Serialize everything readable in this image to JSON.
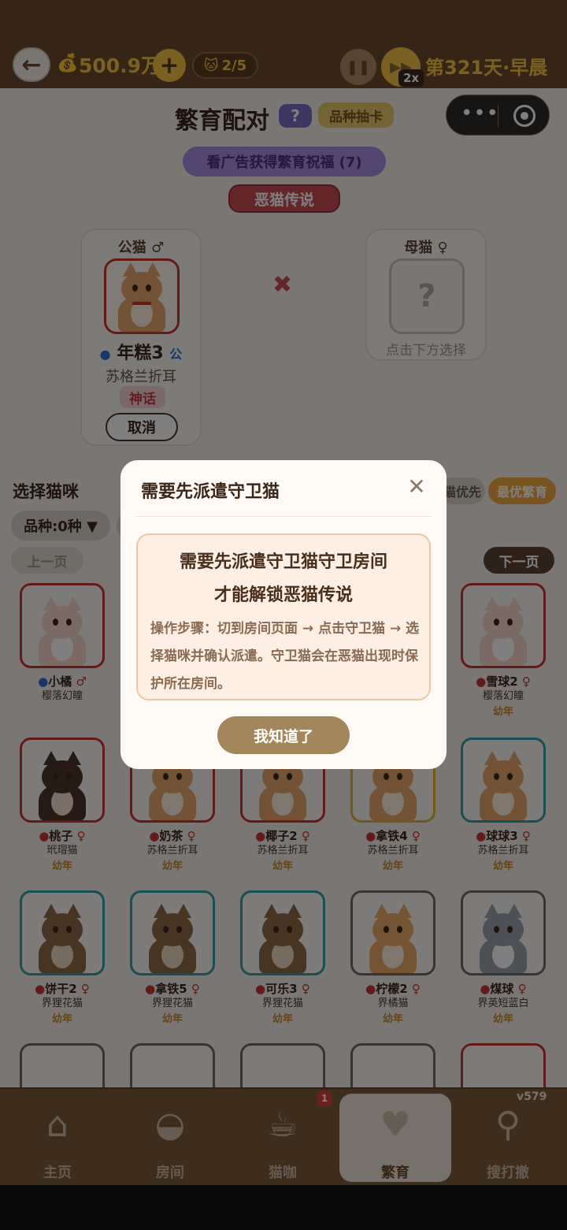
{
  "topbar": {
    "back_icon": "←",
    "money": "500.9万",
    "plus_label": "+",
    "capacity": "2/5",
    "pause_icon": "❚❚",
    "speed_icon": "▶▶",
    "speed_badge": "2x",
    "day": "第321天·早晨"
  },
  "header": {
    "title": "繁育配对",
    "help_label": "?",
    "gacha_label": "品种抽卡",
    "ad_blessing": "看广告获得繁育祝福 (7)",
    "evil_cat": "恶猫传说"
  },
  "pair": {
    "male_title": "公猫 ♂",
    "male_name": "年糕3",
    "male_sex": "公",
    "male_breed": "苏格兰折耳",
    "male_rarity": "神话",
    "cancel_label": "取消",
    "cross": "✖",
    "female_title": "母猫 ♀",
    "female_placeholder": "?",
    "female_hint": "点击下方选择"
  },
  "select": {
    "title": "选择猫咪",
    "priority_chip": "猫优先",
    "best_chip": "最优繁育",
    "breed_filter": "品种:0种 ▼",
    "prev_label": "上一页",
    "next_label": "下一页"
  },
  "cats": [
    {
      "name": "小橘",
      "sex": "♂",
      "breed": "樱落幻瞳",
      "age": "",
      "frame": "red",
      "dot": "blue",
      "coat": "#f3d6c8",
      "chest": "#ffffff"
    },
    {
      "name": "雪球2",
      "sex": "♀",
      "breed": "樱落幻瞳",
      "age": "幼年",
      "frame": "red",
      "dot": "red",
      "coat": "#f3d6c8",
      "chest": "#ffffff"
    },
    {
      "name": "桃子",
      "sex": "♀",
      "breed": "玳瑁猫",
      "age": "幼年",
      "frame": "red",
      "dot": "red",
      "coat": "#4a3628",
      "chest": "#f0e0cc"
    },
    {
      "name": "奶茶",
      "sex": "♀",
      "breed": "苏格兰折耳",
      "age": "幼年",
      "frame": "red",
      "dot": "red",
      "coat": "#e6a56a",
      "chest": "#fbeee0"
    },
    {
      "name": "椰子2",
      "sex": "♀",
      "breed": "苏格兰折耳",
      "age": "幼年",
      "frame": "red",
      "dot": "red",
      "coat": "#e6a56a",
      "chest": "#fbeee0"
    },
    {
      "name": "拿铁4",
      "sex": "♀",
      "breed": "苏格兰折耳",
      "age": "幼年",
      "frame": "gold",
      "dot": "red",
      "coat": "#e6a56a",
      "chest": "#fbeee0"
    },
    {
      "name": "球球3",
      "sex": "♀",
      "breed": "苏格兰折耳",
      "age": "幼年",
      "frame": "teal",
      "dot": "red",
      "coat": "#e6a56a",
      "chest": "#fbeee0"
    },
    {
      "name": "饼干2",
      "sex": "♀",
      "breed": "界狸花猫",
      "age": "幼年",
      "frame": "teal",
      "dot": "red",
      "coat": "#8a6a44",
      "chest": "#e8d8c0"
    },
    {
      "name": "拿铁5",
      "sex": "♀",
      "breed": "界狸花猫",
      "age": "幼年",
      "frame": "teal",
      "dot": "red",
      "coat": "#8a6a44",
      "chest": "#e8d8c0"
    },
    {
      "name": "可乐3",
      "sex": "♀",
      "breed": "界狸花猫",
      "age": "幼年",
      "frame": "teal",
      "dot": "red",
      "coat": "#8a6a44",
      "chest": "#e8d8c0"
    },
    {
      "name": "柠檬2",
      "sex": "♀",
      "breed": "界橘猫",
      "age": "幼年",
      "frame": "gray",
      "dot": "red",
      "coat": "#e8a866",
      "chest": "#fbeee0"
    },
    {
      "name": "煤球",
      "sex": "♀",
      "breed": "界英短蓝白",
      "age": "幼年",
      "frame": "gray",
      "dot": "red",
      "coat": "#9aa2ac",
      "chest": "#ffffff"
    }
  ],
  "dialog": {
    "title": "需要先派遣守卫猫",
    "close_icon": "✕",
    "headline_1": "需要先派遣守卫猫守卫房间",
    "headline_2": "才能解锁恶猫传说",
    "steps": "操作步骤：切到房间页面 → 点击守卫猫 → 选择猫咪并确认派遣。守卫猫会在恶猫出现时保护所在房间。",
    "ok_label": "我知道了"
  },
  "nav": {
    "items": [
      {
        "label": "主页",
        "icon": "house-icon",
        "glyph": "⌂"
      },
      {
        "label": "房间",
        "icon": "bowl-icon",
        "glyph": "◒"
      },
      {
        "label": "猫咖",
        "icon": "cat-cup-icon",
        "glyph": "☕"
      },
      {
        "label": "繁育",
        "icon": "breeding-cats-icon",
        "glyph": "♥"
      },
      {
        "label": "搜打撤",
        "icon": "magnifier-icon",
        "glyph": "⚲"
      }
    ],
    "badge": "1",
    "version": "v579"
  },
  "colors": {
    "topbar": "#6b4a2c",
    "accent_gold": "#f6c343",
    "rarity_red": "#c23c3a",
    "dialog_button": "#a4865d"
  }
}
